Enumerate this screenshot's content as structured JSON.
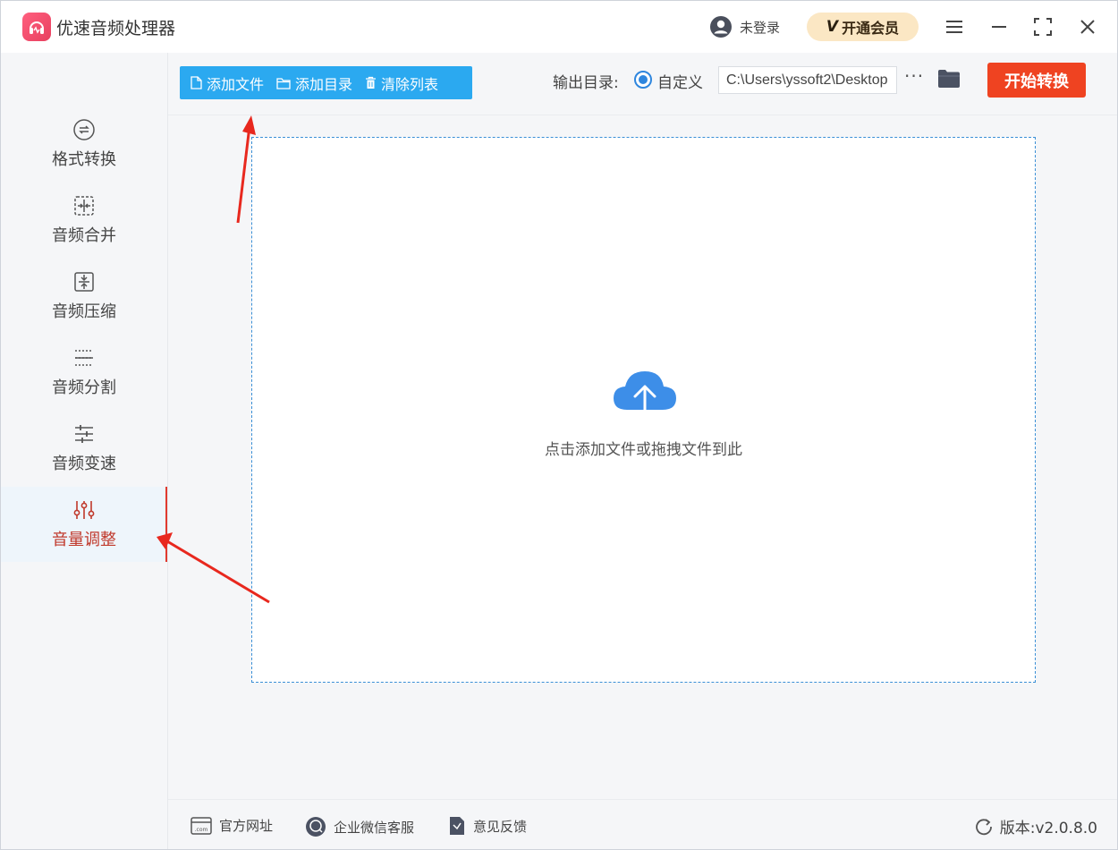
{
  "app": {
    "title": "优速音频处理器",
    "login_text": "未登录",
    "vip_badge": "V",
    "vip_label": "开通会员"
  },
  "sidebar": {
    "items": [
      {
        "label": "格式转换",
        "icon": "format-convert-icon"
      },
      {
        "label": "音频合并",
        "icon": "merge-icon"
      },
      {
        "label": "音频压缩",
        "icon": "compress-icon"
      },
      {
        "label": "音频分割",
        "icon": "split-icon"
      },
      {
        "label": "音频变速",
        "icon": "speed-icon"
      },
      {
        "label": "音量调整",
        "icon": "volume-adjust-icon",
        "active": true
      }
    ]
  },
  "toolbar": {
    "add_file": "添加文件",
    "add_folder": "添加目录",
    "clear_list": "清除列表",
    "output_label": "输出目录:",
    "output_option": "自定义",
    "output_path": "C:\\Users\\yssoft2\\Desktop",
    "more": "···",
    "start": "开始转换"
  },
  "dropzone": {
    "hint": "点击添加文件或拖拽文件到此"
  },
  "footer": {
    "website": "官方网址",
    "wechat": "企业微信客服",
    "feedback": "意见反馈",
    "version": "版本:v2.0.8.0"
  },
  "colors": {
    "accent_blue": "#2ba9f0",
    "start_red": "#ef4321",
    "active_red": "#c0392b",
    "vip_bg": "#fbe7c4"
  }
}
